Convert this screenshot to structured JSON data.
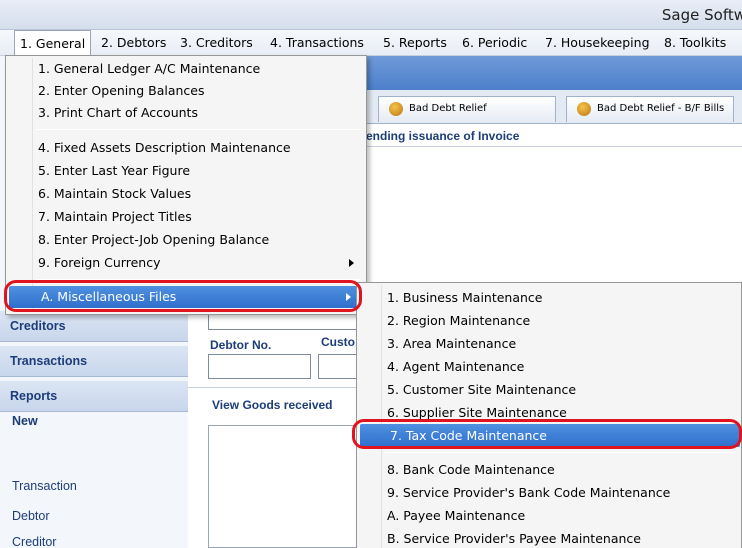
{
  "window": {
    "title": "Sage Softw"
  },
  "menubar": {
    "items": [
      {
        "label": "1. General",
        "active": true
      },
      {
        "label": "2. Debtors"
      },
      {
        "label": "3. Creditors"
      },
      {
        "label": "4. Transactions"
      },
      {
        "label": "5. Reports"
      },
      {
        "label": "6. Periodic"
      },
      {
        "label": "7. Housekeeping"
      },
      {
        "label": "8. Toolkits"
      }
    ]
  },
  "general_menu": {
    "items": [
      {
        "label": "1. General Ledger A/C Maintenance"
      },
      {
        "label": "2. Enter Opening Balances"
      },
      {
        "label": "3. Print Chart of Accounts"
      },
      {
        "label": "4. Fixed Assets Description Maintenance"
      },
      {
        "label": "5. Enter Last Year Figure"
      },
      {
        "label": "6. Maintain Stock Values"
      },
      {
        "label": "7. Maintain Project Titles"
      },
      {
        "label": "8. Enter Project-Job Opening Balance"
      },
      {
        "label": "9. Foreign Currency"
      },
      {
        "label": "A. Miscellaneous Files"
      }
    ]
  },
  "misc_submenu": {
    "items": [
      {
        "label": "1. Business Maintenance"
      },
      {
        "label": "2. Region Maintenance"
      },
      {
        "label": "3. Area Maintenance"
      },
      {
        "label": "4. Agent Maintenance"
      },
      {
        "label": "5. Customer Site Maintenance"
      },
      {
        "label": "6. Supplier Site Maintenance"
      },
      {
        "label": "7. Tax Code Maintenance"
      },
      {
        "label": "8. Bank Code Maintenance"
      },
      {
        "label": "9. Service Provider's Bank Code Maintenance"
      },
      {
        "label": "A. Payee Maintenance"
      },
      {
        "label": "B. Service Provider's Payee Maintenance"
      }
    ]
  },
  "tabs": [
    {
      "label": "Bad Debt Relief"
    },
    {
      "label": "Bad Debt Relief - B/F Bills"
    }
  ],
  "content": {
    "section1_title": "ending issuance of Invoice",
    "debtor_no_label": "Debtor No.",
    "customer_label": "Custo",
    "section2_title": "View Goods received"
  },
  "left_nav": {
    "buttons": [
      {
        "label": "Creditors"
      },
      {
        "label": "Transactions"
      },
      {
        "label": "Reports"
      }
    ],
    "new_heading": "New",
    "links": [
      {
        "label": "Transaction"
      },
      {
        "label": "Debtor"
      },
      {
        "label": "Creditor"
      }
    ]
  },
  "colors": {
    "highlight": "#3b7fd6",
    "annotation": "#e0141e",
    "nav_text": "#1d3d78"
  }
}
